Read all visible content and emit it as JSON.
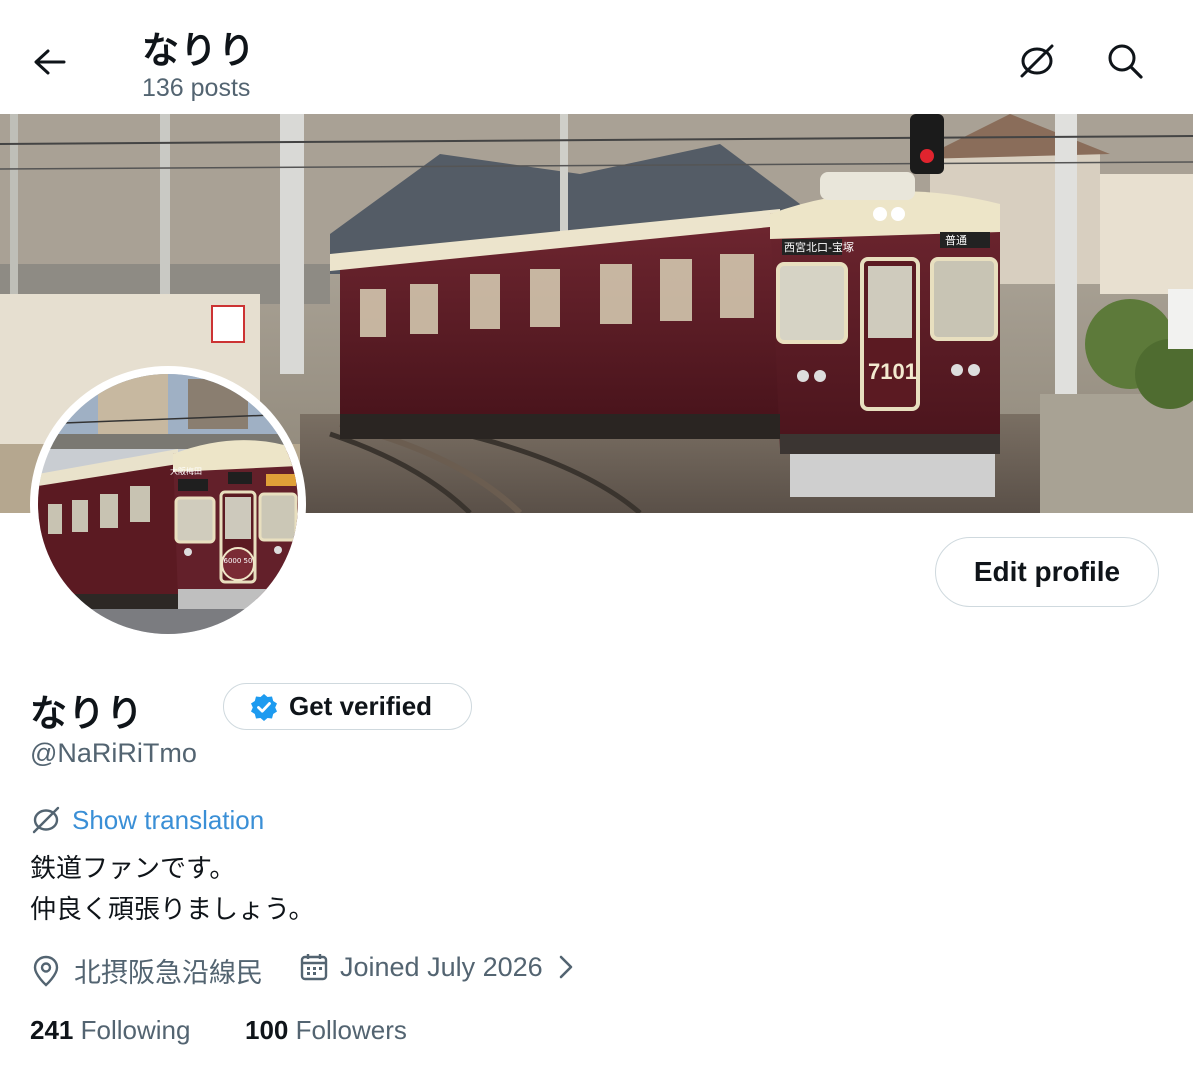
{
  "header": {
    "title": "なりり",
    "post_count": "136 posts",
    "icons": [
      "back-arrow-icon",
      "translate-icon",
      "search-icon"
    ]
  },
  "banner": {
    "train_number": "7101",
    "destination_sign": "西宮北口-宝塚",
    "type_sign": "普通"
  },
  "avatar": {
    "front_sign": "大阪梅田",
    "emblem_text": "6000 50"
  },
  "actions": {
    "edit_profile": "Edit profile",
    "get_verified": "Get verified"
  },
  "profile": {
    "display_name": "なりり",
    "handle": "@NaRiRiTmo",
    "show_translation": "Show translation",
    "bio_line1": "鉄道ファンです。",
    "bio_line2": "仲良く頑張りましょう。",
    "location": "北摂阪急沿線民",
    "joined": "Joined July 2026"
  },
  "stats": {
    "following_count": "241",
    "following_label": "Following",
    "followers_count": "100",
    "followers_label": "Followers"
  },
  "colors": {
    "accent": "#1d9bf0",
    "train_maroon": "#5b1a22",
    "text_secondary": "#536471"
  }
}
